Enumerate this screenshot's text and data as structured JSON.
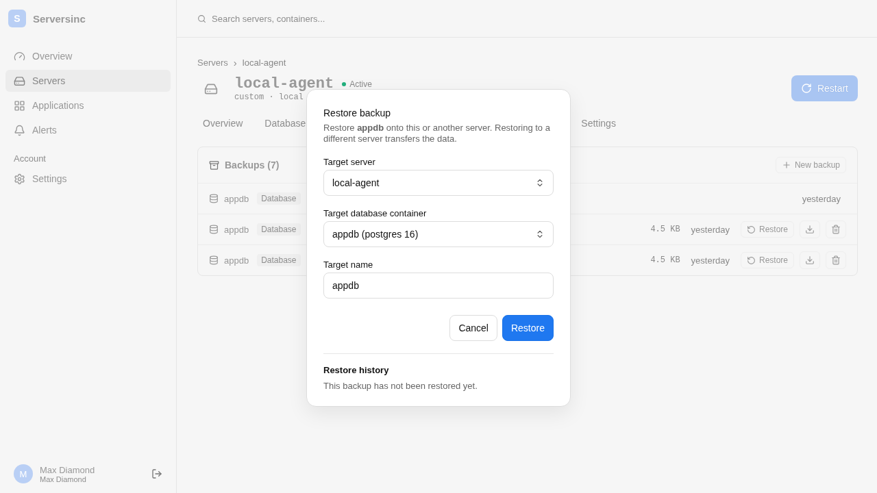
{
  "brand": {
    "logo_letter": "S",
    "name": "Serversinc"
  },
  "search": {
    "placeholder": "Search servers, containers..."
  },
  "sidebar": {
    "items": [
      {
        "label": "Overview",
        "selected": false
      },
      {
        "label": "Servers",
        "selected": true
      },
      {
        "label": "Applications",
        "selected": false
      },
      {
        "label": "Alerts",
        "selected": false
      }
    ],
    "section": "Account",
    "account_items": [
      {
        "label": "Settings",
        "selected": false
      }
    ]
  },
  "user": {
    "initial": "M",
    "name": "Max Diamond",
    "subtitle": "Max Diamond"
  },
  "breadcrumb": {
    "parent": "Servers",
    "separator": "›",
    "current": "local-agent"
  },
  "server": {
    "name": "local-agent",
    "status": "Active",
    "subtitle": "custom · local"
  },
  "restart_button": "Restart",
  "tabs": [
    {
      "label": "Overview"
    },
    {
      "label": "Database"
    },
    {
      "label": "Settings"
    }
  ],
  "backups": {
    "title": "Backups (7)",
    "new_button": "New backup",
    "rows": [
      {
        "kind": "summary",
        "name": "appdb",
        "tag": "Database",
        "time": "yesterday"
      },
      {
        "kind": "full",
        "name": "appdb",
        "tag": "Database",
        "size": "4.5 KB",
        "time": "yesterday",
        "restore": "Restore"
      },
      {
        "kind": "full",
        "name": "appdb",
        "tag": "Database",
        "size": "4.5 KB",
        "time": "yesterday",
        "restore": "Restore"
      }
    ]
  },
  "modal": {
    "title": "Restore backup",
    "description": "Restore **appdb** onto this or another server. Restoring to a different server transfers the data.",
    "fields": [
      {
        "label": "Target server",
        "kind": "select",
        "value": "local-agent"
      },
      {
        "label": "Target database container",
        "kind": "select",
        "value": "appdb (postgres 16)"
      },
      {
        "label": "Target name",
        "kind": "text",
        "value": "appdb"
      }
    ],
    "buttons": [
      {
        "label": "Cancel",
        "kind": "secondary"
      },
      {
        "label": "Restore",
        "kind": "primary"
      }
    ],
    "history": {
      "title": "Restore history",
      "text": "This backup has not been restored yet."
    }
  }
}
